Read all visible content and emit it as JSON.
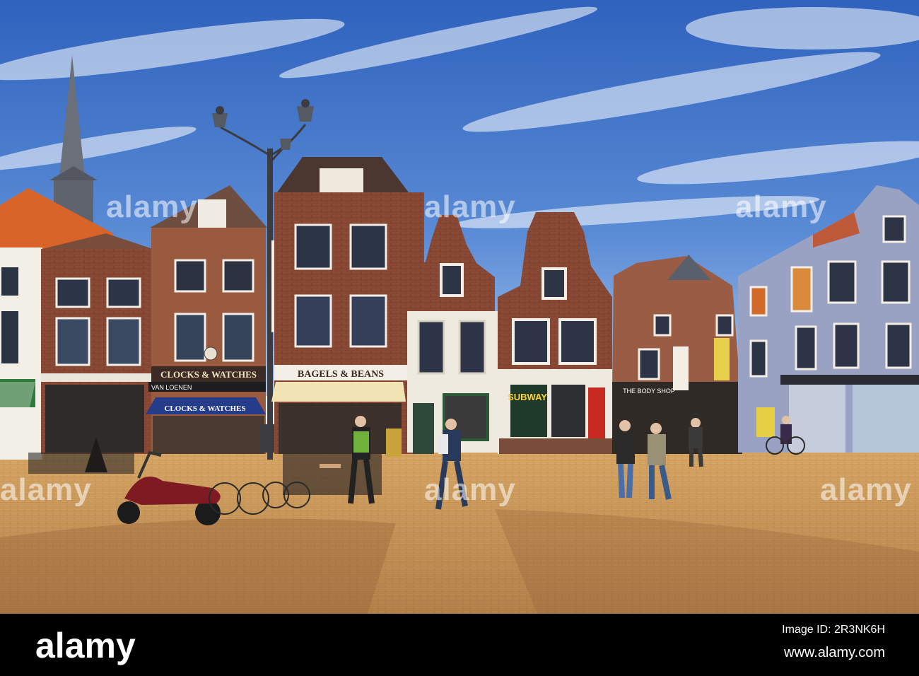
{
  "scene": {
    "signs": {
      "clocks_upper": "CLOCKS & WATCHES",
      "clocks_awning": "CLOCKS & WATCHES",
      "van_loenen": "VAN LOENEN",
      "bagels": "BAGELS & BEANS",
      "subway": "SUBWAY",
      "body_shop": "THE BODY SHOP"
    },
    "colors": {
      "sky": "#3f74c9",
      "sky_light": "#a9c6ee",
      "pavement": "#c9975b",
      "brick": "#8a4a35",
      "roof_orange": "#d8642a"
    }
  },
  "watermark": {
    "text": "alamy"
  },
  "footer": {
    "logo": "alamy",
    "image_id": "Image ID: 2R3NK6H",
    "url": "www.alamy.com"
  }
}
